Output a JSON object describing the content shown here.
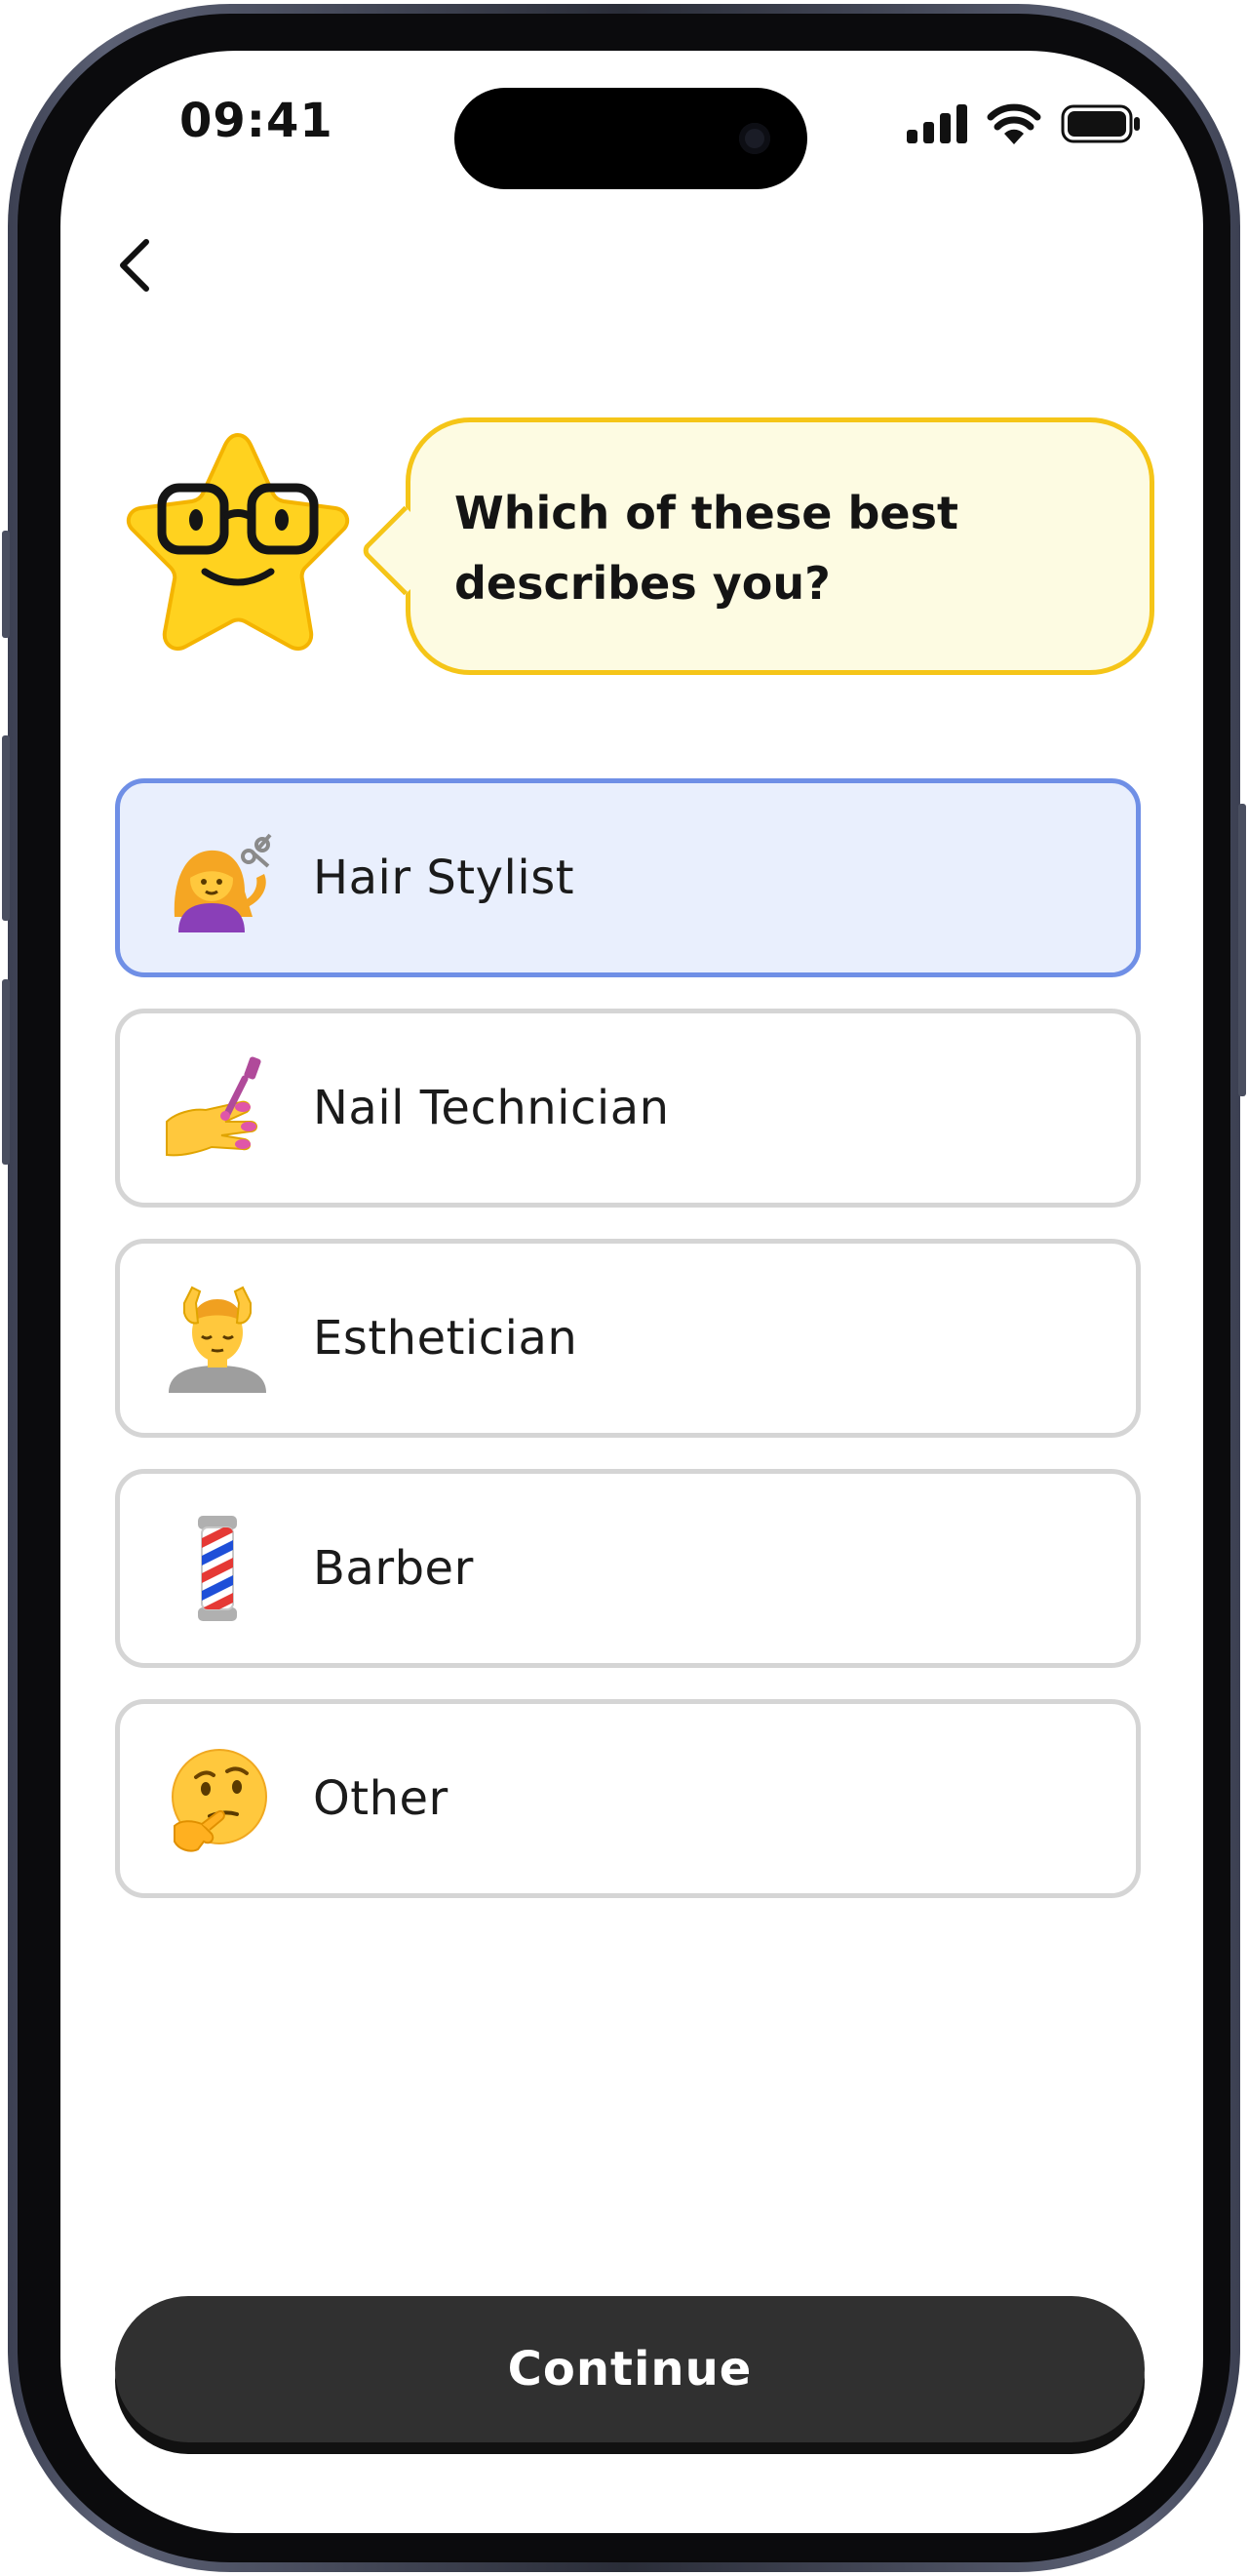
{
  "status_bar": {
    "time": "09:41",
    "icons": [
      "cellular-signal-icon",
      "wifi-icon",
      "battery-icon"
    ]
  },
  "navigation": {
    "back_icon": "chevron-left-icon"
  },
  "prompt": {
    "mascot_icon": "star-mascot-with-glasses-icon",
    "question": "Which of these best describes you?"
  },
  "options": [
    {
      "label": "Hair Stylist",
      "icon": "hair-stylist-emoji-icon",
      "selected": true
    },
    {
      "label": "Nail Technician",
      "icon": "nail-polish-emoji-icon",
      "selected": false
    },
    {
      "label": "Esthetician",
      "icon": "face-massage-emoji-icon",
      "selected": false
    },
    {
      "label": "Barber",
      "icon": "barber-pole-emoji-icon",
      "selected": false
    },
    {
      "label": "Other",
      "icon": "thinking-face-emoji-icon",
      "selected": false
    }
  ],
  "footer": {
    "continue_label": "Continue"
  },
  "colors": {
    "selected_background": "#e9effd",
    "selected_border": "#6f8fe6",
    "bubble_background": "#fdfbe2",
    "bubble_border": "#f5c518",
    "button_background": "#303030"
  }
}
